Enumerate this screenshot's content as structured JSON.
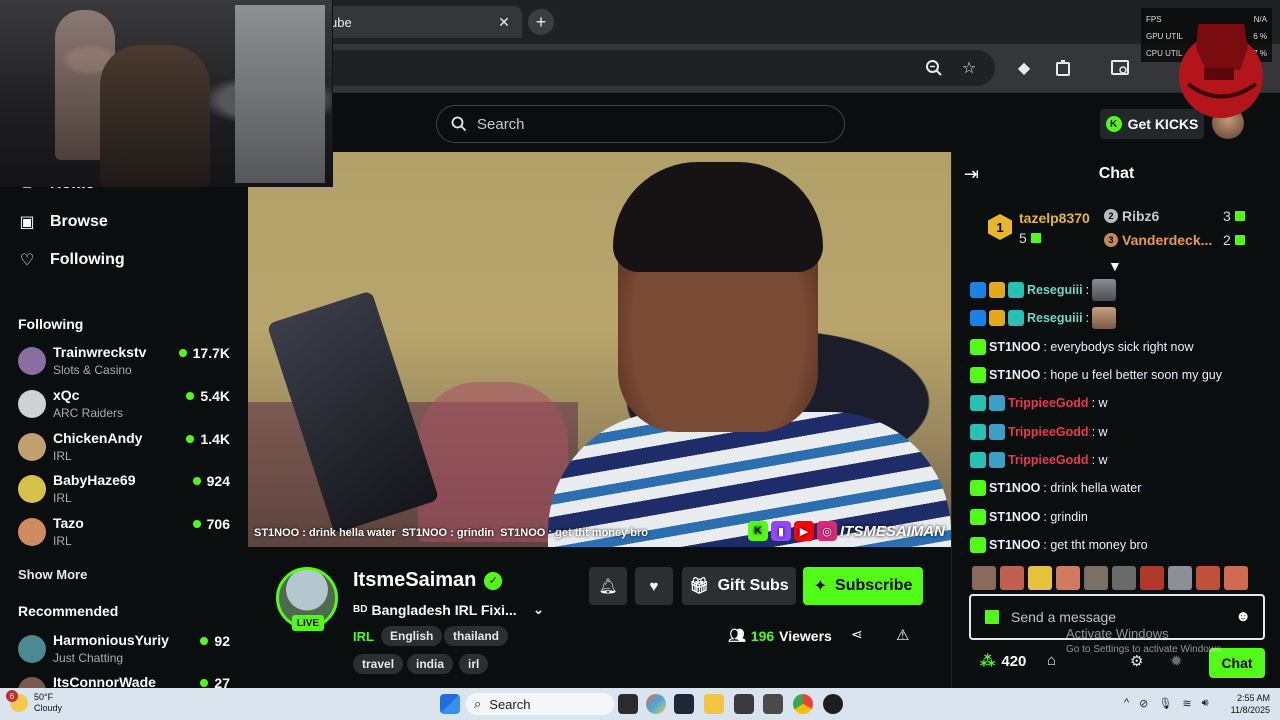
{
  "browser": {
    "tab_title": "ube",
    "tab_close": "✕",
    "new_tab": "+"
  },
  "overlay": {
    "stats": [
      {
        "label": "FPS",
        "value": "N/A"
      },
      {
        "label": "GPU UTIL",
        "value": "6 %"
      },
      {
        "label": "CPU UTIL",
        "value": "27 %"
      }
    ]
  },
  "topbar": {
    "search_placeholder": "Search",
    "get_kicks": "Get KICKS"
  },
  "sidebar": {
    "nav": [
      {
        "label": "Home",
        "icon": "home-icon"
      },
      {
        "label": "Browse",
        "icon": "browse-icon"
      },
      {
        "label": "Following",
        "icon": "heart-icon"
      }
    ],
    "following_title": "Following",
    "following": [
      {
        "name": "Trainwreckstv",
        "category": "Slots & Casino",
        "viewers": "17.7K",
        "color": "#8a6ea0"
      },
      {
        "name": "xQc",
        "category": "ARC Raiders",
        "viewers": "5.4K",
        "color": "#cfd2d4"
      },
      {
        "name": "ChickenAndy",
        "category": "IRL",
        "viewers": "1.4K",
        "color": "#c0a070"
      },
      {
        "name": "BabyHaze69",
        "category": "IRL",
        "viewers": "924",
        "color": "#d6c24a"
      },
      {
        "name": "Tazo",
        "category": "IRL",
        "viewers": "706",
        "color": "#d08a60"
      }
    ],
    "show_more": "Show More",
    "recommended_title": "Recommended",
    "recommended": [
      {
        "name": "HarmoniousYuriy",
        "category": "Just Chatting",
        "viewers": "92",
        "color": "#4a8a90"
      },
      {
        "name": "ItsConnorWade",
        "category": "",
        "viewers": "27",
        "color": "#7a5a4a"
      }
    ]
  },
  "video": {
    "overlay_chat": [
      {
        "user": "ST1NOO",
        "text": ": drink hella water"
      },
      {
        "user": "ST1NOO",
        "text": ": grindin"
      },
      {
        "user": "ST1NOO",
        "text": ": get tht money bro"
      }
    ],
    "handle": "ITSMESAIMAN"
  },
  "channel": {
    "name": "ItsmeSaiman",
    "live": "LIVE",
    "flag": "BD",
    "title": "Bangladesh IRL Fixi...",
    "category": "IRL",
    "tags": [
      "English",
      "thailand",
      "travel",
      "india",
      "irl"
    ],
    "gift_subs": "Gift Subs",
    "subscribe": "Subscribe",
    "viewers_count": "196",
    "viewers_label": "Viewers"
  },
  "chat": {
    "title": "Chat",
    "leaderboard": {
      "first": {
        "rank": "1",
        "name": "tazelp8370",
        "count": "5"
      },
      "second": {
        "rank": "2",
        "name": "Ribz6",
        "count": "3"
      },
      "third": {
        "rank": "3",
        "name": "Vanderdeck...",
        "count": "2"
      }
    },
    "messages": [
      {
        "user": "Reseguiii",
        "text": ":",
        "user_color": "#6fd3c8",
        "badges": [
          "mod",
          "crown",
          "vip"
        ],
        "emote": true
      },
      {
        "user": "Reseguiii",
        "text": ":",
        "user_color": "#6fd3c8",
        "badges": [
          "mod",
          "crown",
          "vip"
        ],
        "emote": true
      },
      {
        "user": "ST1NOO",
        "text": ": everybodys sick right now",
        "user_color": "#e6e8e9",
        "badges": [
          "sub"
        ],
        "emote": false
      },
      {
        "user": "ST1NOO",
        "text": ": hope u feel better soon my guy",
        "user_color": "#e6e8e9",
        "badges": [
          "sub"
        ],
        "emote": false
      },
      {
        "user": "TrippieeGodd",
        "text": ": w",
        "user_color": "#e8384f",
        "badges": [
          "vip",
          "mod"
        ],
        "emote": false
      },
      {
        "user": "TrippieeGodd",
        "text": ": w",
        "user_color": "#e8384f",
        "badges": [
          "vip",
          "mod"
        ],
        "emote": false
      },
      {
        "user": "TrippieeGodd",
        "text": ": w",
        "user_color": "#e8384f",
        "badges": [
          "vip",
          "mod"
        ],
        "emote": false
      },
      {
        "user": "ST1NOO",
        "text": ": drink hella water",
        "user_color": "#e6e8e9",
        "badges": [
          "sub"
        ],
        "emote": false
      },
      {
        "user": "ST1NOO",
        "text": ": grindin",
        "user_color": "#e6e8e9",
        "badges": [
          "sub"
        ],
        "emote": false
      },
      {
        "user": "ST1NOO",
        "text": ": get tht money bro",
        "user_color": "#e6e8e9",
        "badges": [
          "sub"
        ],
        "emote": false
      }
    ],
    "input_placeholder": "Send a message",
    "points": "420",
    "chat_button": "Chat"
  },
  "watermark": {
    "line1": "Activate Windows",
    "line2": "Go to Settings to activate Windows."
  },
  "taskbar": {
    "weather_badge": "6",
    "temperature": "50°F",
    "condition": "Cloudy",
    "search": "Search",
    "time": "2:55 AM",
    "date": "11/8/2025"
  }
}
